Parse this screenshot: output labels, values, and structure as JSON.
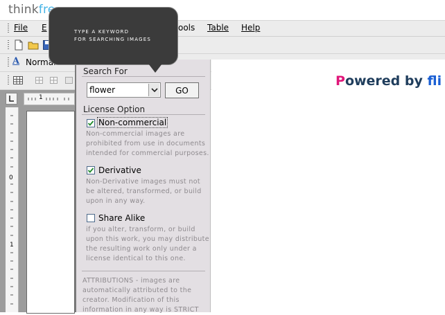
{
  "logo": {
    "part1": "think",
    "part2": "fre"
  },
  "menu": {
    "items": [
      {
        "label": "File"
      },
      {
        "label": "E"
      },
      {
        "label": "ools"
      },
      {
        "label": "Table"
      },
      {
        "label": "Help"
      }
    ]
  },
  "toolbar": {
    "style_value": "Normal"
  },
  "ruler": {
    "h_tick": "1",
    "v_ticks": [
      "0",
      "1"
    ]
  },
  "tooltip": {
    "line1": "TYPE A KEYWORD",
    "line2": "FOR SEARCHING IMAGES"
  },
  "search": {
    "heading": "Search For",
    "value": "flower",
    "go_label": "GO"
  },
  "license": {
    "heading": "License Option",
    "options": [
      {
        "label": "Non-commercial",
        "checked": true,
        "desc": [
          "Non-commercial images are",
          "prohibited from use in documents",
          "intended for commercial purposes."
        ]
      },
      {
        "label": "Derivative",
        "checked": true,
        "desc": [
          "Non-Derivative images must not",
          "be altered, transformed, or build",
          "upon in any way."
        ]
      },
      {
        "label": "Share Alike",
        "checked": false,
        "desc": [
          "if you alter, transform, or build",
          "upon this work, you may distribute",
          "the resulting work only under a",
          "license identical to this one."
        ]
      }
    ]
  },
  "attributions": {
    "lines": [
      "ATTRIBUTIONS - images are",
      "automatically attributed to the",
      "creator. Modification of this",
      "information in any way is STRICT"
    ]
  },
  "powered": {
    "p": "P",
    "rest": "owered by ",
    "brand": "fli"
  },
  "colors": {
    "accent_pink": "#e0177a",
    "accent_blue": "#1a5fd4",
    "panel_bg": "#e3dfe3",
    "tooltip_bg": "#3b3b3b"
  }
}
